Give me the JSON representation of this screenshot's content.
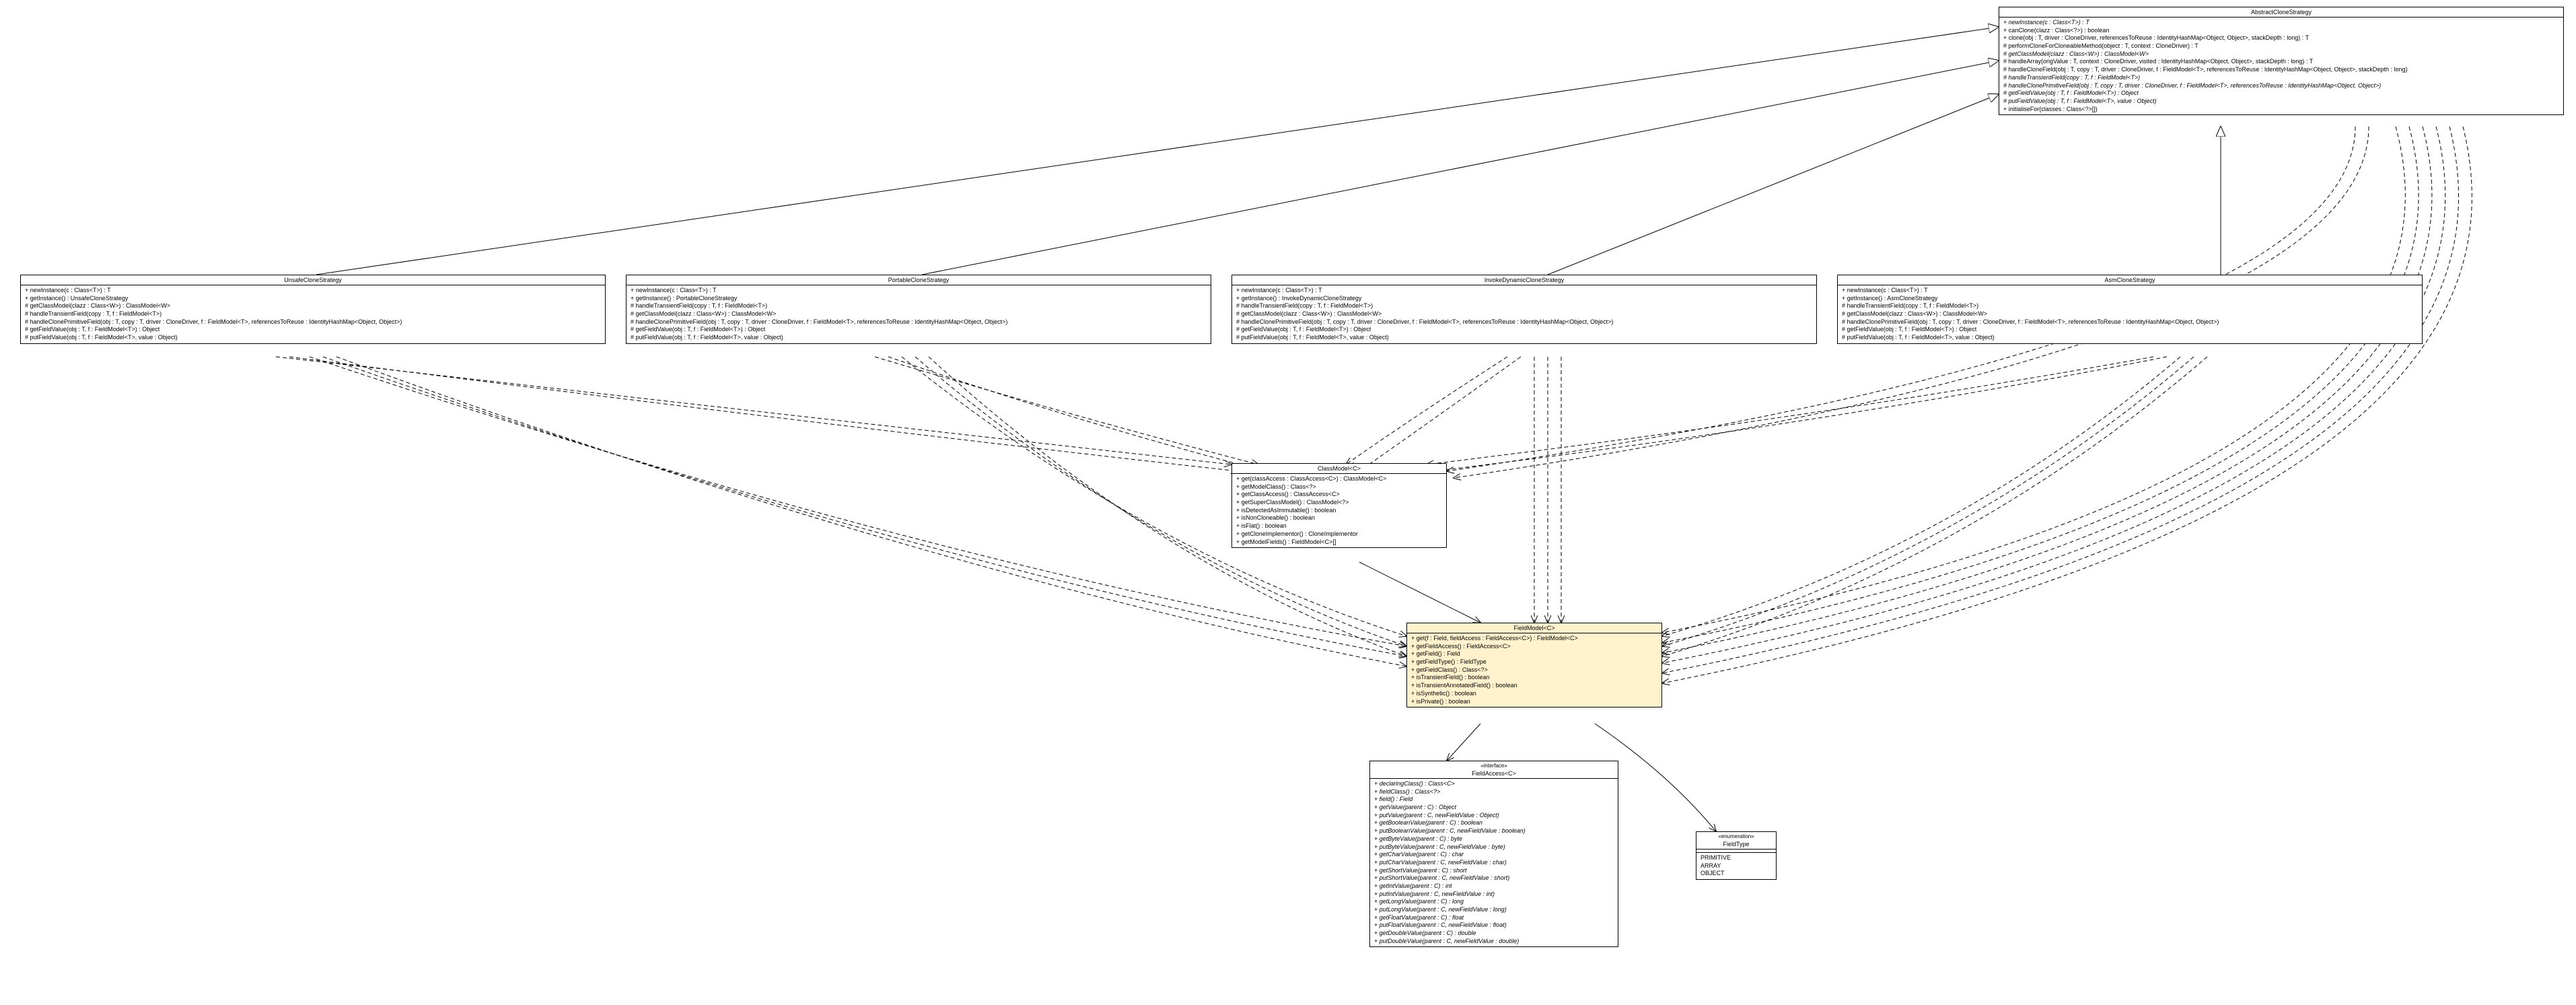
{
  "classes": {
    "abstractCloneStrategy": {
      "title": "AbstractCloneStrategy",
      "stereotype": "",
      "members": [
        {
          "t": "+ newInstance(c : Class<T>) : T",
          "i": true
        },
        {
          "t": "+ canClone(clazz : Class<?>) : boolean"
        },
        {
          "t": "+ clone(obj : T, driver : CloneDriver, referencesToReuse : IdentityHashMap<Object, Object>, stackDepth : long) : T"
        },
        {
          "t": "# performCloneForCloneableMethod(object : T, context : CloneDriver) : T"
        },
        {
          "t": "# getClassModel(clazz : Class<W>) : ClassModel<W>",
          "i": true
        },
        {
          "t": "# handleArray(origValue : T, context : CloneDriver, visited : IdentityHashMap<Object, Object>, stackDepth : long) : T"
        },
        {
          "t": "# handleCloneField(obj : T, copy : T, driver : CloneDriver, f : FieldModel<T>, referencesToReuse : IdentityHashMap<Object, Object>, stackDepth : long)"
        },
        {
          "t": "# handleTransientField(copy : T, f : FieldModel<T>)",
          "i": true
        },
        {
          "t": "# handleClonePrimitiveField(obj : T, copy : T, driver : CloneDriver, f : FieldModel<T>, referencesToReuse : IdentityHashMap<Object, Object>)",
          "i": true
        },
        {
          "t": "# getFieldValue(obj : T, f : FieldModel<T>) : Object",
          "i": true
        },
        {
          "t": "# putFieldValue(obj : T, f : FieldModel<T>, value : Object)",
          "i": true
        },
        {
          "t": "+ initialiseFor(classes : Class<?>[])"
        }
      ]
    },
    "unsafeCloneStrategy": {
      "title": "UnsafeCloneStrategy",
      "members": [
        {
          "t": "+ newInstance(c : Class<T>) : T"
        },
        {
          "t": "+ getInstance() : UnsafeCloneStrategy"
        },
        {
          "t": "# getClassModel(clazz : Class<W>) : ClassModel<W>"
        },
        {
          "t": "# handleTransientField(copy : T, f : FieldModel<T>)"
        },
        {
          "t": "# handleClonePrimitiveField(obj : T, copy : T, driver : CloneDriver, f : FieldModel<T>, referencesToReuse : IdentityHashMap<Object, Object>)"
        },
        {
          "t": "# getFieldValue(obj : T, f : FieldModel<T>) : Object"
        },
        {
          "t": "# putFieldValue(obj : T, f : FieldModel<T>, value : Object)"
        }
      ]
    },
    "portableCloneStrategy": {
      "title": "PortableCloneStrategy",
      "members": [
        {
          "t": "+ newInstance(c : Class<T>) : T"
        },
        {
          "t": "+ getInstance() : PortableCloneStrategy"
        },
        {
          "t": "# handleTransientField(copy : T, f : FieldModel<T>)"
        },
        {
          "t": "# getClassModel(clazz : Class<W>) : ClassModel<W>"
        },
        {
          "t": "# handleClonePrimitiveField(obj : T, copy : T, driver : CloneDriver, f : FieldModel<T>, referencesToReuse : IdentityHashMap<Object, Object>)"
        },
        {
          "t": "# getFieldValue(obj : T, f : FieldModel<T>) : Object"
        },
        {
          "t": "# putFieldValue(obj : T, f : FieldModel<T>, value : Object)"
        }
      ]
    },
    "invokeDynamicCloneStrategy": {
      "title": "InvokeDynamicCloneStrategy",
      "members": [
        {
          "t": "+ newInstance(c : Class<T>) : T"
        },
        {
          "t": "+ getInstance() : InvokeDynamicCloneStrategy"
        },
        {
          "t": "# handleTransientField(copy : T, f : FieldModel<T>)"
        },
        {
          "t": "# getClassModel(clazz : Class<W>) : ClassModel<W>"
        },
        {
          "t": "# handleClonePrimitiveField(obj : T, copy : T, driver : CloneDriver, f : FieldModel<T>, referencesToReuse : IdentityHashMap<Object, Object>)"
        },
        {
          "t": "# getFieldValue(obj : T, f : FieldModel<T>) : Object"
        },
        {
          "t": "# putFieldValue(obj : T, f : FieldModel<T>, value : Object)"
        }
      ]
    },
    "asmCloneStrategy": {
      "title": "AsmCloneStrategy",
      "members": [
        {
          "t": "+ newInstance(c : Class<T>) : T"
        },
        {
          "t": "+ getInstance() : AsmCloneStrategy"
        },
        {
          "t": "# handleTransientField(copy : T, f : FieldModel<T>)"
        },
        {
          "t": "# getClassModel(clazz : Class<W>) : ClassModel<W>"
        },
        {
          "t": "# handleClonePrimitiveField(obj : T, copy : T, driver : CloneDriver, f : FieldModel<T>, referencesToReuse : IdentityHashMap<Object, Object>)"
        },
        {
          "t": "# getFieldValue(obj : T, f : FieldModel<T>) : Object"
        },
        {
          "t": "# putFieldValue(obj : T, f : FieldModel<T>, value : Object)"
        }
      ]
    },
    "classModel": {
      "title": "ClassModel<C>",
      "members": [
        {
          "t": "+ get(classAccess : ClassAccess<C>) : ClassModel<C>"
        },
        {
          "t": "+ getModelClass() : Class<?>"
        },
        {
          "t": "+ getClassAccess() : ClassAccess<C>"
        },
        {
          "t": "+ getSuperClassModel() : ClassModel<?>"
        },
        {
          "t": "+ isDetectedAsImmutable() : boolean"
        },
        {
          "t": "+ isNonCloneable() : boolean"
        },
        {
          "t": "+ isFlat() : boolean"
        },
        {
          "t": "+ getCloneImplementor() : CloneImplementor"
        },
        {
          "t": "+ getModelFields() : FieldModel<C>[]"
        }
      ]
    },
    "fieldModel": {
      "title": "FieldModel<C>",
      "members": [
        {
          "t": "+ get(f : Field, fieldAccess : FieldAccess<C>) : FieldModel<C>"
        },
        {
          "t": "+ getFieldAccess() : FieldAccess<C>"
        },
        {
          "t": "+ getField() : Field"
        },
        {
          "t": "+ getFieldType() : FieldType"
        },
        {
          "t": "+ getFieldClass() : Class<?>"
        },
        {
          "t": "+ isTransientField() : boolean"
        },
        {
          "t": "+ isTransientAnnotatedField() : boolean"
        },
        {
          "t": "+ isSynthetic() : boolean"
        },
        {
          "t": "+ isPrivate() : boolean"
        }
      ]
    },
    "fieldAccess": {
      "title": "FieldAccess<C>",
      "stereotype": "«interface»",
      "members": [
        {
          "t": "+ declaringClass() : Class<C>",
          "i": true
        },
        {
          "t": "+ fieldClass() : Class<?>",
          "i": true
        },
        {
          "t": "+ field() : Field",
          "i": true
        },
        {
          "t": "+ getValue(parent : C) : Object",
          "i": true
        },
        {
          "t": "+ putValue(parent : C, newFieldValue : Object)",
          "i": true
        },
        {
          "t": "+ getBooleanValue(parent : C) : boolean",
          "i": true
        },
        {
          "t": "+ putBooleanValue(parent : C, newFieldValue : boolean)",
          "i": true
        },
        {
          "t": "+ getByteValue(parent : C) : byte",
          "i": true
        },
        {
          "t": "+ putByteValue(parent : C, newFieldValue : byte)",
          "i": true
        },
        {
          "t": "+ getCharValue(parent : C) : char",
          "i": true
        },
        {
          "t": "+ putCharValue(parent : C, newFieldValue : char)",
          "i": true
        },
        {
          "t": "+ getShortValue(parent : C) : short",
          "i": true
        },
        {
          "t": "+ putShortValue(parent : C, newFieldValue : short)",
          "i": true
        },
        {
          "t": "+ getIntValue(parent : C) : int",
          "i": true
        },
        {
          "t": "+ putIntValue(parent : C, newFieldValue : int)",
          "i": true
        },
        {
          "t": "+ getLongValue(parent : C) : long",
          "i": true
        },
        {
          "t": "+ putLongValue(parent : C, newFieldValue : long)",
          "i": true
        },
        {
          "t": "+ getFloatValue(parent : C) : float",
          "i": true
        },
        {
          "t": "+ putFloatValue(parent : C, newFieldValue : float)",
          "i": true
        },
        {
          "t": "+ getDoubleValue(parent : C) : double",
          "i": true
        },
        {
          "t": "+ putDoubleValue(parent : C, newFieldValue : double)",
          "i": true
        }
      ]
    },
    "fieldType": {
      "title": "FieldType",
      "stereotype": "«enumeration»",
      "values": [
        "PRIMITIVE",
        "ARRAY",
        "OBJECT"
      ]
    }
  }
}
